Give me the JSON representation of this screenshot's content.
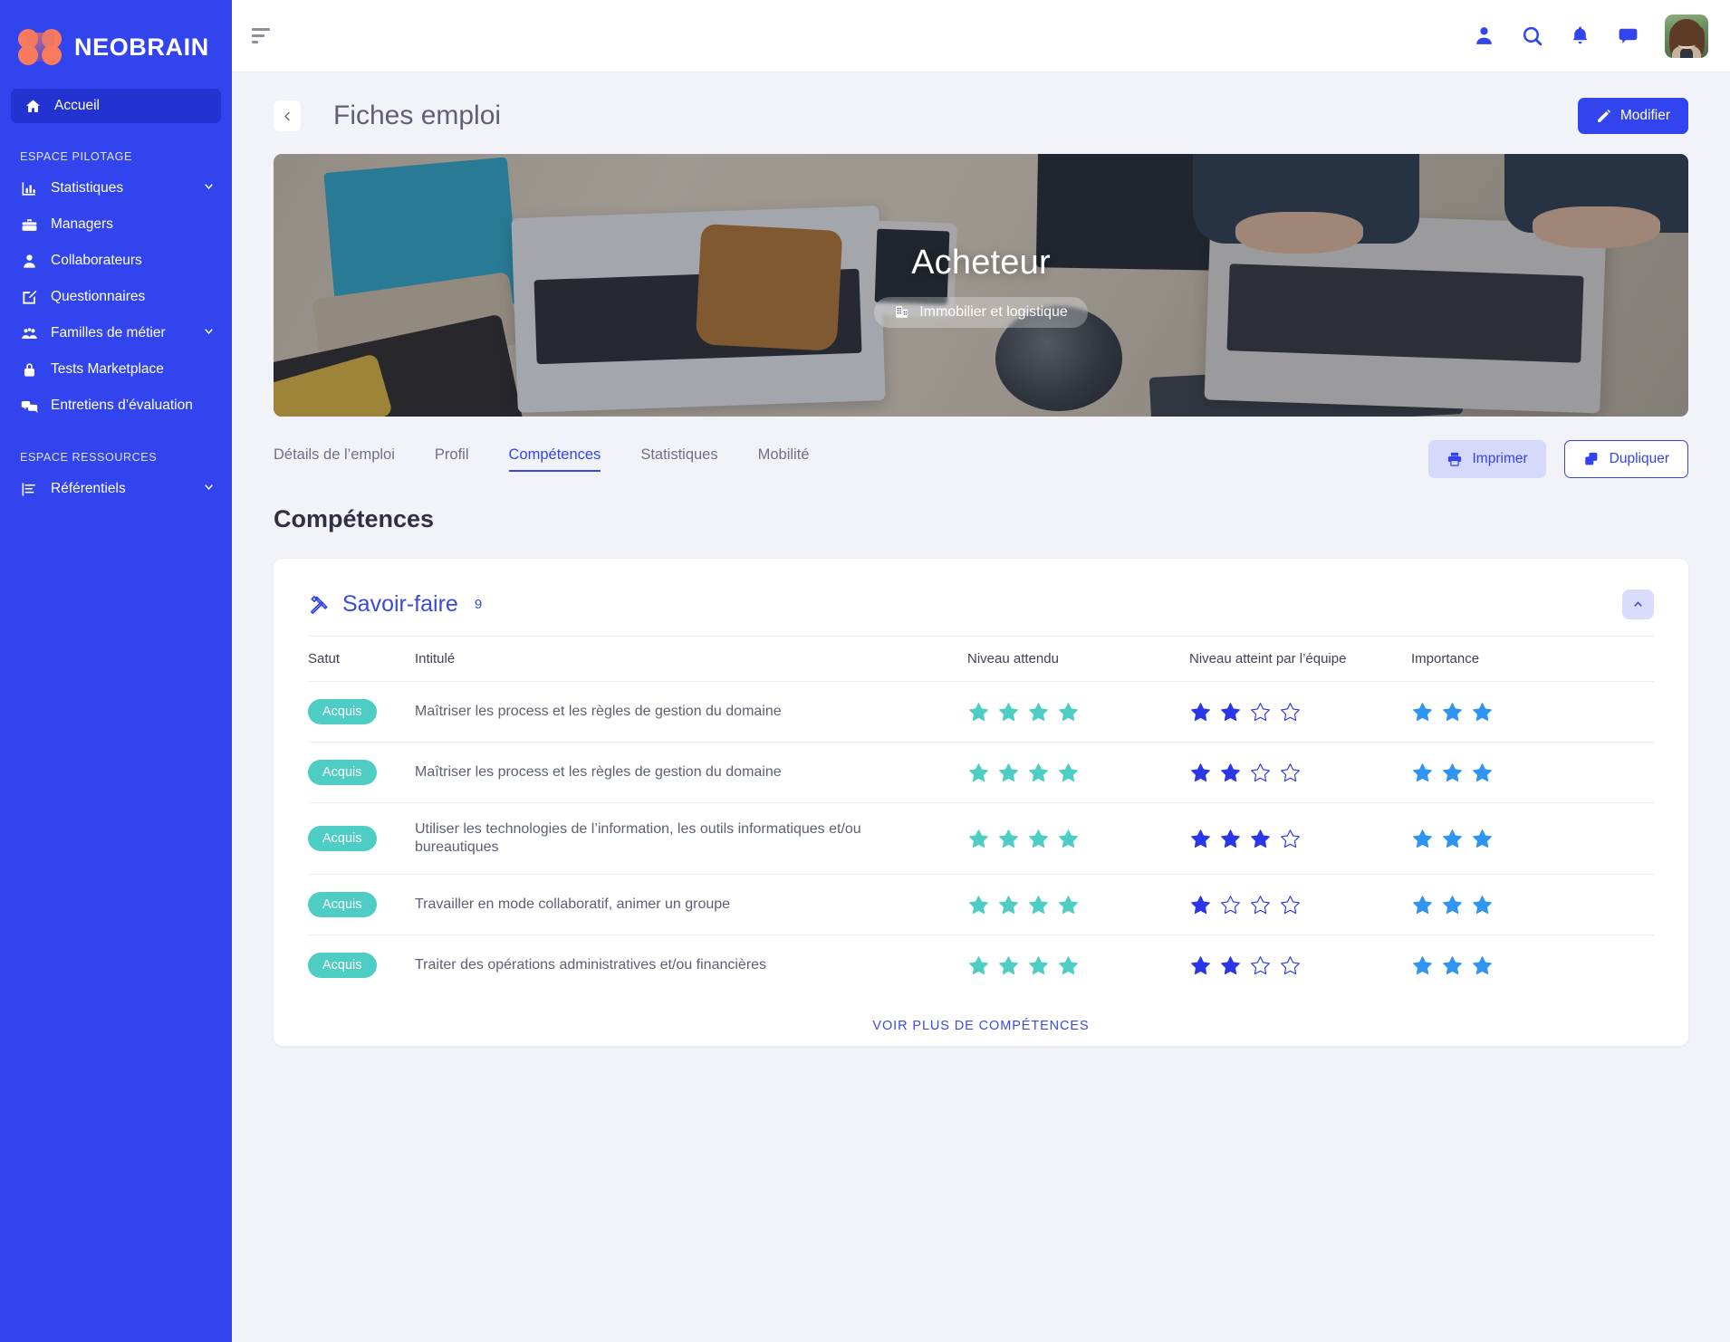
{
  "brand": {
    "name": "NEOBRAIN",
    "logo_icon": "neobrain-logo"
  },
  "sidebar": {
    "home": {
      "label": "Accueil",
      "icon": "home-icon"
    },
    "sections": [
      {
        "label": "ESPACE PILOTAGE",
        "items": [
          {
            "label": "Statistiques",
            "icon": "bar-chart-icon",
            "expandable": true
          },
          {
            "label": "Managers",
            "icon": "briefcase-icon",
            "expandable": false
          },
          {
            "label": "Collaborateurs",
            "icon": "person-icon",
            "expandable": false
          },
          {
            "label": "Questionnaires",
            "icon": "edit-square-icon",
            "expandable": false
          },
          {
            "label": "Familles de métier",
            "icon": "people-group-icon",
            "expandable": true
          },
          {
            "label": "Tests Marketplace",
            "icon": "lock-icon",
            "expandable": false
          },
          {
            "label": "Entretiens d’évaluation",
            "icon": "chat-bubbles-icon",
            "expandable": false
          }
        ]
      },
      {
        "label": "ESPACE RESSOURCES",
        "items": [
          {
            "label": "Référentiels",
            "icon": "list-chart-icon",
            "expandable": true
          }
        ]
      }
    ]
  },
  "topbar": {
    "menu_icon": "sort-lines-icon",
    "icons": [
      "person-icon",
      "search-icon",
      "bell-icon",
      "chat-icon"
    ],
    "avatar": "user-avatar"
  },
  "page": {
    "back_icon": "chevron-left-icon",
    "title": "Fiches emploi",
    "edit_button": {
      "label": "Modifier",
      "icon": "pencil-icon"
    }
  },
  "hero": {
    "title": "Acheteur",
    "badge": {
      "label": "Immobilier et logistique",
      "icon": "building-icon"
    }
  },
  "tabs": [
    {
      "label": "Détails de l’emploi",
      "active": false
    },
    {
      "label": "Profil",
      "active": false
    },
    {
      "label": "Compétences",
      "active": true
    },
    {
      "label": "Statistiques",
      "active": false
    },
    {
      "label": "Mobilité",
      "active": false
    }
  ],
  "tab_actions": [
    {
      "label": "Imprimer",
      "icon": "printer-icon",
      "style": "soft"
    },
    {
      "label": "Dupliquer",
      "icon": "copy-icon",
      "style": "outline"
    }
  ],
  "section": {
    "heading": "Compétences"
  },
  "card": {
    "icon": "crossed-tools-icon",
    "title": "Savoir-faire",
    "count": "9",
    "collapse_icon": "chevron-up-icon",
    "columns": [
      "Satut",
      "Intitulé",
      "Niveau attendu",
      "Niveau atteint par l’équipe",
      "Importance"
    ],
    "max_expected": 4,
    "max_achieved": 4,
    "max_importance": 3,
    "colors": {
      "expected_star": "#4ecdc4",
      "achieved_star": "#2a36e8",
      "achieved_empty_stroke": "#2a36e8",
      "importance_star": "#2f94f2",
      "badge": "#4ecdc4",
      "accent": "#3244ee"
    },
    "rows": [
      {
        "status": "Acquis",
        "title": "Maîtriser les process et les règles de gestion du domaine",
        "expected": 4,
        "achieved": 2,
        "importance": 3
      },
      {
        "status": "Acquis",
        "title": "Maîtriser les process et les règles de gestion du domaine",
        "expected": 4,
        "achieved": 2,
        "importance": 3
      },
      {
        "status": "Acquis",
        "title": "Utiliser les technologies de l’information, les outils informatiques et/ou bureautiques",
        "expected": 4,
        "achieved": 3,
        "importance": 3
      },
      {
        "status": "Acquis",
        "title": "Travailler en mode collaboratif, animer un groupe",
        "expected": 4,
        "achieved": 1,
        "importance": 3
      },
      {
        "status": "Acquis",
        "title": "Traiter des opérations administratives et/ou financières",
        "expected": 4,
        "achieved": 2,
        "importance": 3
      }
    ],
    "more_label": "VOIR PLUS DE COMPÉTENCES"
  }
}
